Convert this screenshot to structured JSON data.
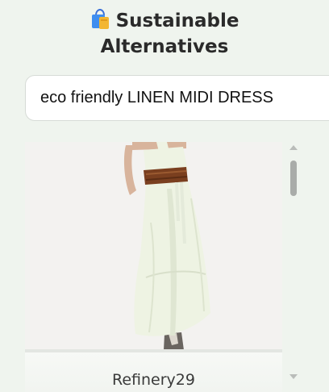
{
  "header": {
    "title_line1": "Sustainable",
    "title_line2": "Alternatives",
    "icon": "shopping-bag-icon"
  },
  "search": {
    "value": "eco friendly LINEN MIDI DRESS"
  },
  "results": [
    {
      "brand": "Refinery29",
      "image": "linen-midi-dress-product-photo"
    }
  ],
  "colors": {
    "page_background": "#eff4ee",
    "dress": "#eef3e3",
    "belt": "#7a3f1f",
    "scrollbar": "#a9aca9"
  }
}
